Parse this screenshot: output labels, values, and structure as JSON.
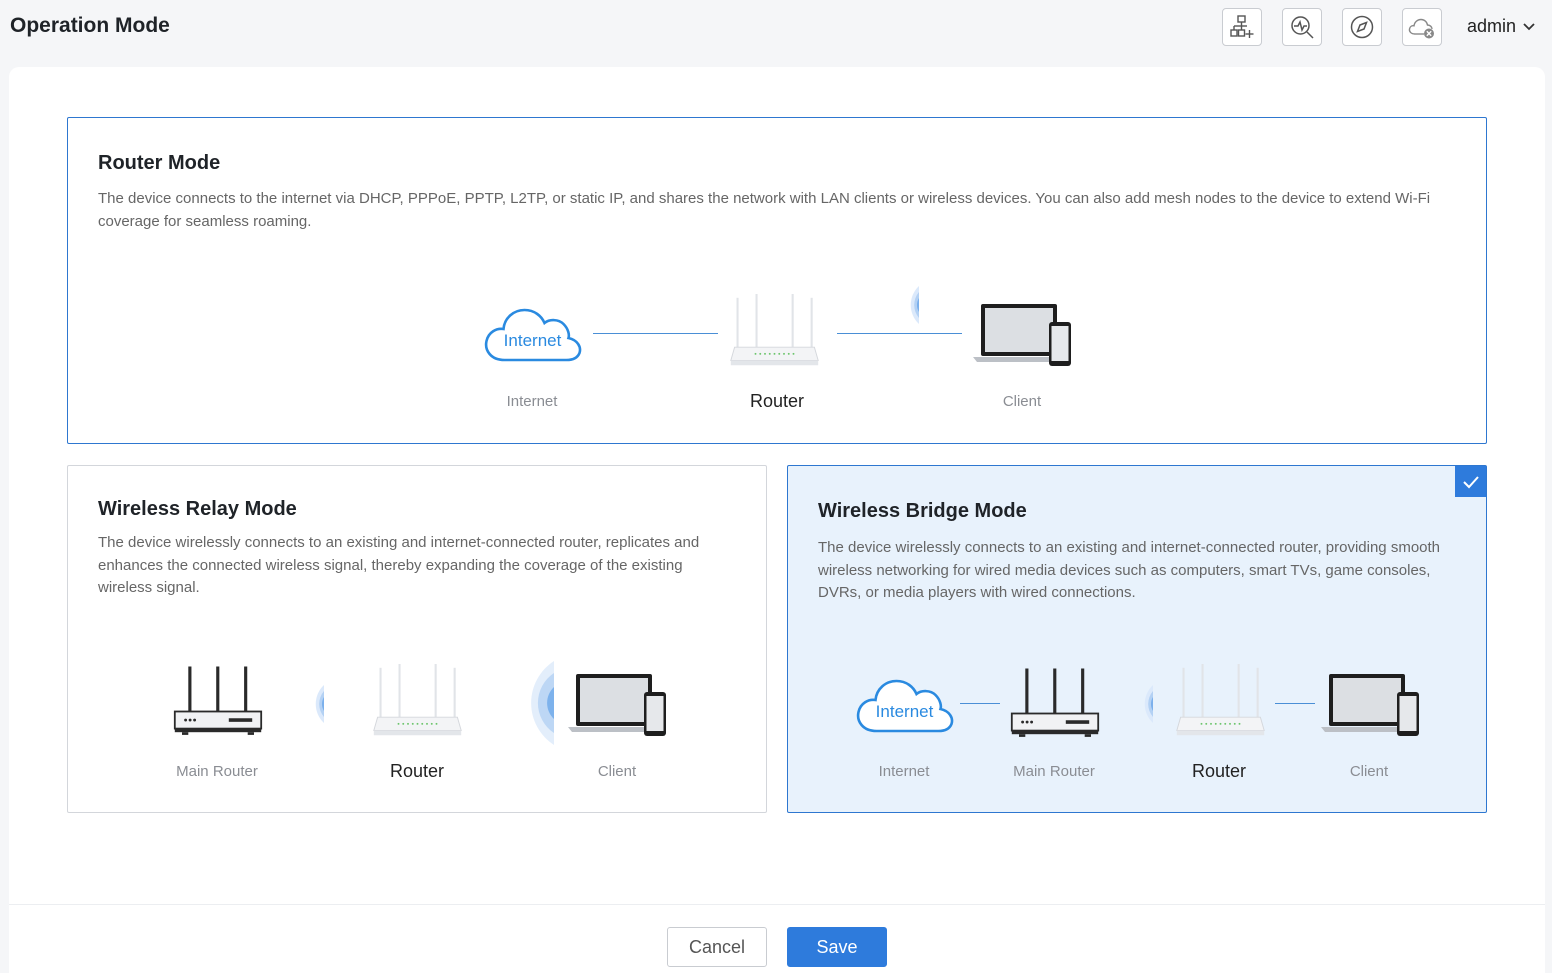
{
  "header": {
    "title": "Operation Mode",
    "user": "admin",
    "icons": [
      "network-add-icon",
      "diagnostics-icon",
      "compass-icon",
      "cloud-disconnected-icon"
    ]
  },
  "router_mode": {
    "title": "Router Mode",
    "description": "The device connects to the internet via DHCP, PPPoE, PPTP, L2TP, or static IP, and shares the network with LAN clients or wireless devices. You can also add mesh nodes to the device to extend Wi-Fi coverage for seamless roaming.",
    "cloud_text": "Internet",
    "labels": {
      "internet": "Internet",
      "router": "Router",
      "client": "Client"
    }
  },
  "relay_mode": {
    "title": "Wireless Relay Mode",
    "description": "The device wirelessly connects to an existing and internet-connected router, replicates and enhances the connected wireless signal, thereby expanding the coverage of the existing wireless signal.",
    "labels": {
      "main_router": "Main Router",
      "router": "Router",
      "client": "Client"
    }
  },
  "bridge_mode": {
    "title": "Wireless Bridge Mode",
    "description": "The device wirelessly connects to an existing and internet-connected router, providing smooth wireless networking for wired media devices such as computers, smart TVs, game consoles, DVRs, or media players with wired connections.",
    "cloud_text": "Internet",
    "labels": {
      "internet": "Internet",
      "main_router": "Main Router",
      "router": "Router",
      "client": "Client"
    },
    "selected": true
  },
  "footer": {
    "cancel": "Cancel",
    "save": "Save"
  },
  "colors": {
    "accent": "#2e7bdc",
    "selected_bg": "#e8f2fc",
    "line": "#4a8fd6"
  }
}
